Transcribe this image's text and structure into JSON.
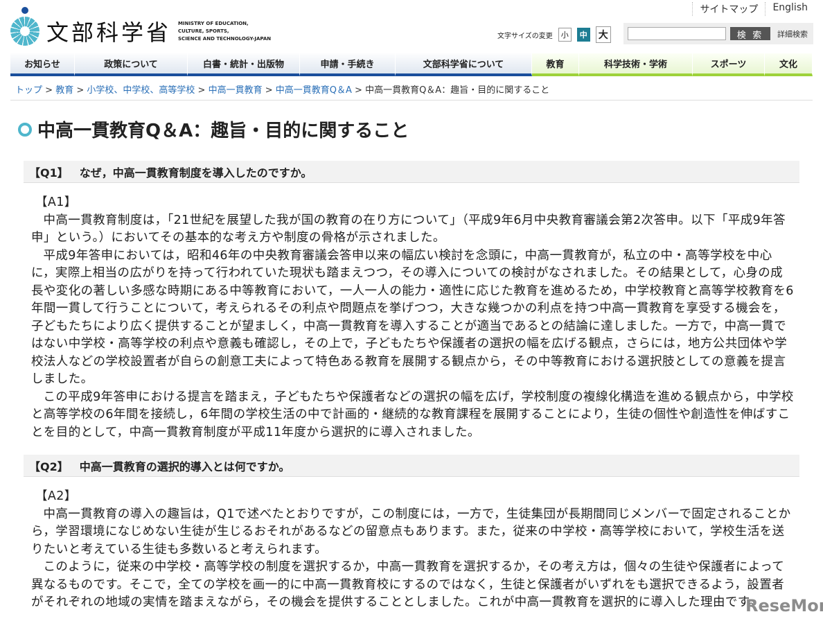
{
  "header": {
    "logo_jp": "文部科学省",
    "logo_en": [
      "MINISTRY OF EDUCATION,",
      "CULTURE, SPORTS,",
      "SCIENCE AND TECHNOLOGY-JAPAN"
    ],
    "links": [
      "サイトマップ",
      "English"
    ],
    "font_size_label": "文字サイズの変更",
    "font_sizes": [
      "小",
      "中",
      "大"
    ],
    "search_placeholder": "",
    "search_button": "検 索",
    "advanced_search": "詳細検索"
  },
  "nav": [
    "お知らせ",
    "政策について",
    "白書・統計・出版物",
    "申請・手続き",
    "文部科学省について",
    "教育",
    "科学技術・学術",
    "スポーツ",
    "文化"
  ],
  "breadcrumb": [
    "トップ",
    "教育",
    "小学校、中学校、高等学校",
    "中高一貫教育",
    "中高一貫教育Q＆A"
  ],
  "breadcrumb_current": "中高一貫教育Q＆A：趣旨・目的に関すること",
  "title": "中高一貫教育Q＆A：趣旨・目的に関すること",
  "qa": [
    {
      "q_label": "【Q1】",
      "q_text": "なぜ，中高一貫教育制度を導入したのですか。",
      "a_label": "【A1】",
      "paragraphs": [
        "中高一貫教育制度は，「21世紀を展望した我が国の教育の在り方について」（平成9年6月中央教育審議会第2次答申。以下「平成9年答申」という。）においてその基本的な考え方や制度の骨格が示されました。",
        "平成9年答申においては，昭和46年の中央教育審議会答申以来の幅広い検討を念頭に，中高一貫教育が，私立の中・高等学校を中心に，実際上相当の広がりを持って行われていた現状も踏まえつつ，その導入についての検討がなされました。その結果として，心身の成長や変化の著しい多感な時期にある中等教育において，一人一人の能力・適性に応じた教育を進めるため，中学校教育と高等学校教育を6年間一貫して行うことについて，考えられるその利点や問題点を挙げつつ，大きな幾つかの利点を持つ中高一貫教育を享受する機会を，子どもたちにより広く提供することが望ましく，中高一貫教育を導入することが適当であるとの結論に達しました。一方で，中高一貫ではない中学校・高等学校の利点や意義も確認し，その上で，子どもたちや保護者の選択の幅を広げる観点，さらには，地方公共団体や学校法人などの学校設置者が自らの創意工夫によって特色ある教育を展開する観点から，その中等教育における選択肢としての意義を提言しました。",
        "この平成9年答申における提言を踏まえ，子どもたちや保護者などの選択の幅を広げ，学校制度の複線化構造を進める観点から，中学校と高等学校の6年間を接続し，6年間の学校生活の中で計画的・継続的な教育課程を展開することにより，生徒の個性や創造性を伸ばすことを目的として，中高一貫教育制度が平成11年度から選択的に導入されました。"
      ]
    },
    {
      "q_label": "【Q2】",
      "q_text": "中高一貫教育の選択的導入とは何ですか。",
      "a_label": "【A2】",
      "paragraphs": [
        "中高一貫教育の導入の趣旨は，Q1で述べたとおりですが，この制度には，一方で，生徒集団が長期間同じメンバーで固定されることから，学習環境になじめない生徒が生じるおそれがあるなどの留意点もあります。また，従来の中学校・高等学校において，学校生活を送りたいと考えている生徒も多数いると考えられます。",
        "このように，従来の中学校・高等学校の制度を選択するか，中高一貫教育を選択するか，その考え方は，個々の生徒や保護者によって異なるものです。そこで，全ての学校を画一的に中高一貫教育校にするのではなく，生徒と保護者がいずれをも選択できるよう，設置者がそれぞれの地域の実情を踏まえながら，その機会を提供することとしました。これが中高一貫教育を選択的に導入した理由です。"
      ]
    }
  ],
  "watermark": "ReseMom"
}
